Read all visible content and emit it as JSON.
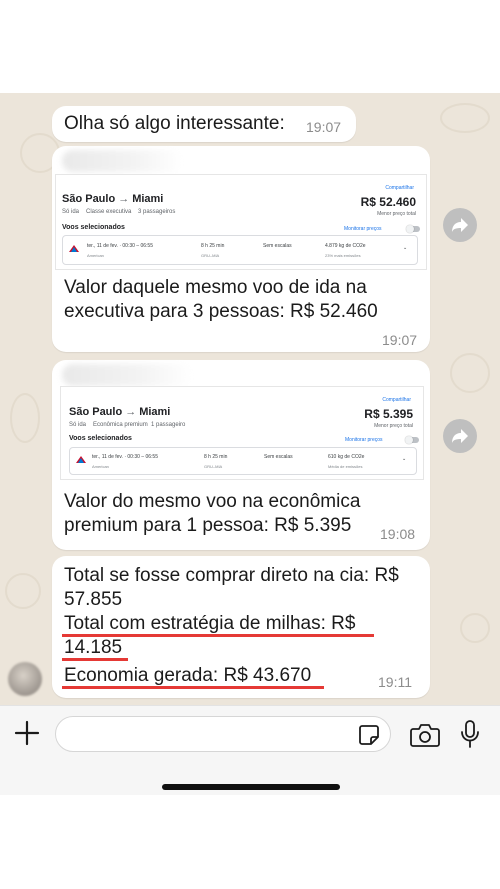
{
  "messages": [
    {
      "text": "Olha só algo interessante:",
      "time": "19:07"
    },
    {
      "card": {
        "origin": "São Paulo",
        "destination": "Miami",
        "price": "R$ 52.460",
        "share_label": "Compartilhar",
        "low_label": "Menor preço total",
        "trip_type": "Só ida",
        "cabin": "Classe executiva",
        "passengers": "3 passageiros",
        "selected_label": "Voos selecionados",
        "monitor_label": "Monitorar preços",
        "flight": {
          "date_time": "ter., 11 de fev. · 00:30 – 06:55",
          "airline": "American",
          "duration": "8 h 25 min",
          "airports": "GRU–MIA",
          "stops": "Sem escalas",
          "emissions": "4.879 kg de CO2e",
          "emissions_note": "23% mais emissões"
        }
      },
      "text": "Valor daquele mesmo voo de ida na executiva para 3 pessoas: R$ 52.460",
      "time": "19:07"
    },
    {
      "card": {
        "origin": "São Paulo",
        "destination": "Miami",
        "price": "R$ 5.395",
        "share_label": "Compartilhar",
        "low_label": "Menor preço total",
        "trip_type": "Só ida",
        "cabin": "Econômica premium",
        "passengers": "1 passageiro",
        "selected_label": "Voos selecionados",
        "monitor_label": "Monitorar preços",
        "flight": {
          "date_time": "ter., 11 de fev. · 00:30 – 06:55",
          "airline": "American",
          "duration": "8 h 25 min",
          "airports": "GRU–MIA",
          "stops": "Sem escalas",
          "emissions": "610 kg de CO2e",
          "emissions_note": "Média de emissões"
        }
      },
      "text": "Valor do mesmo voo na econômica premium para 1 pessoa: R$ 5.395",
      "time": "19:08"
    },
    {
      "lines": [
        "Total se fosse comprar direto na cia: R$",
        "57.855",
        "Total com estratégia de milhas: R$",
        "14.185",
        "Economia gerada: R$ 43.670"
      ],
      "time": "19:11"
    }
  ],
  "input": {
    "placeholder": ""
  },
  "icons": {
    "attach": "plus-icon",
    "sticker": "sticker-icon",
    "camera": "camera-icon",
    "mic": "microphone-icon",
    "forward": "forward-icon"
  },
  "colors": {
    "chat_bg": "#ece5da",
    "underline": "#e53935",
    "link": "#1a73e8"
  }
}
